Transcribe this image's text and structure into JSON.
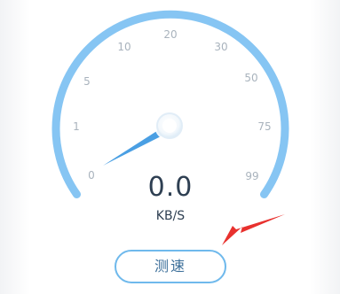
{
  "gauge": {
    "tick_labels": [
      "0",
      "1",
      "5",
      "10",
      "20",
      "30",
      "50",
      "75",
      "99"
    ],
    "colors": {
      "arc": "#86c5f3",
      "needle": "#4a9fe3",
      "hub_ring": "#dcebf7",
      "tick_label": "#a9b3bd"
    }
  },
  "readout": {
    "speed": "0.0",
    "unit": "KB/S"
  },
  "actions": {
    "test_button_label": "测速"
  },
  "annotation": {
    "arrow_color": "#e8312e"
  }
}
